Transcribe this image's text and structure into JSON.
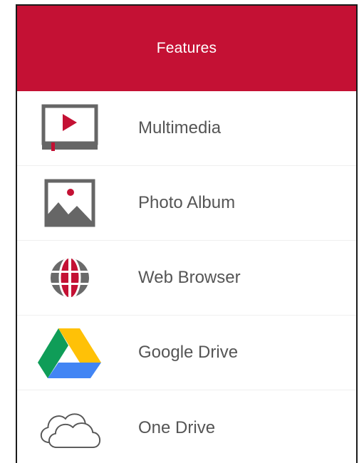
{
  "header": {
    "title": "Features"
  },
  "items": [
    {
      "label": "Multimedia",
      "icon": "multimedia-icon"
    },
    {
      "label": "Photo Album",
      "icon": "photo-album-icon"
    },
    {
      "label": "Web Browser",
      "icon": "web-browser-icon"
    },
    {
      "label": "Google Drive",
      "icon": "google-drive-icon"
    },
    {
      "label": "One Drive",
      "icon": "one-drive-icon"
    }
  ],
  "colors": {
    "header_bg": "#c41134",
    "accent_red": "#c41134",
    "icon_gray": "#666666",
    "label_text": "#555555"
  }
}
